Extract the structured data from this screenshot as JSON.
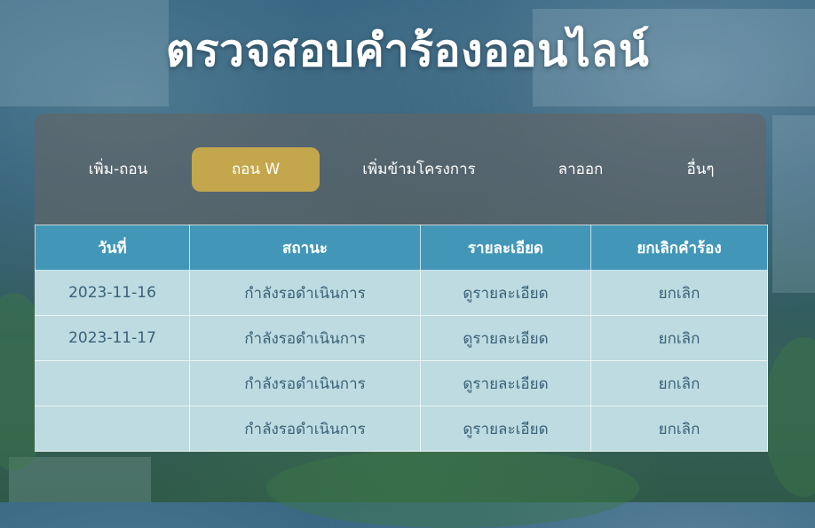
{
  "page": {
    "title": "ตรวจสอบคำร้องออนไลน์"
  },
  "tabs": [
    {
      "label": "เพิ่ม-ถอน",
      "active": false
    },
    {
      "label": "ถอน W",
      "active": true
    },
    {
      "label": "เพิ่มข้ามโครงการ",
      "active": false
    },
    {
      "label": "ลาออก",
      "active": false
    },
    {
      "label": "อื่นๆ",
      "active": false
    }
  ],
  "table": {
    "headers": [
      "วันที่",
      "สถานะ",
      "รายละเอียด",
      "ยกเลิกคำร้อง"
    ],
    "rows": [
      {
        "date": "2023-11-16",
        "status": "กำลังรอดำเนินการ",
        "detail": "ดูรายละเอียด",
        "cancel": "ยกเลิก"
      },
      {
        "date": "2023-11-17",
        "status": "กำลังรอดำเนินการ",
        "detail": "ดูรายละเอียด",
        "cancel": "ยกเลิก"
      },
      {
        "date": "",
        "status": "กำลังรอดำเนินการ",
        "detail": "ดูรายละเอียด",
        "cancel": "ยกเลิก"
      },
      {
        "date": "",
        "status": "กำลังรอดำเนินการ",
        "detail": "ดูรายละเอียด",
        "cancel": "ยกเลิก"
      }
    ]
  },
  "colors": {
    "active_tab": "#c4a74c",
    "table_header": "#4297b9",
    "table_cell": "#c3e1e8",
    "cell_text": "#3a6178"
  }
}
